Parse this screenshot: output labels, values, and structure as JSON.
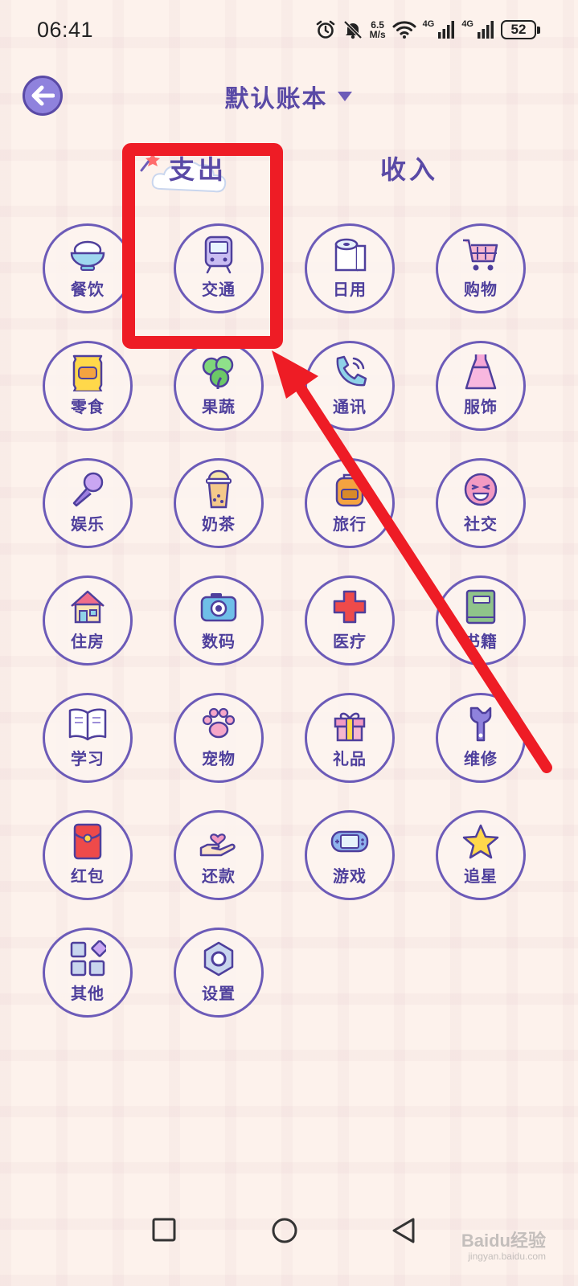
{
  "status_bar": {
    "time": "06:41",
    "speed_value": "6.5",
    "speed_unit": "M/s",
    "net1": "4G",
    "net2": "4G",
    "battery": "52"
  },
  "header": {
    "book_title": "默认账本"
  },
  "tabs": {
    "expense": "支出",
    "income": "收入"
  },
  "categories": [
    {
      "label": "餐饮",
      "icon": "rice-bowl-icon"
    },
    {
      "label": "交通",
      "icon": "train-icon"
    },
    {
      "label": "日用",
      "icon": "tissue-roll-icon"
    },
    {
      "label": "购物",
      "icon": "shopping-cart-icon"
    },
    {
      "label": "零食",
      "icon": "snack-bag-icon"
    },
    {
      "label": "果蔬",
      "icon": "vegetable-icon"
    },
    {
      "label": "通讯",
      "icon": "phone-icon"
    },
    {
      "label": "服饰",
      "icon": "dress-icon"
    },
    {
      "label": "娱乐",
      "icon": "microphone-icon"
    },
    {
      "label": "奶茶",
      "icon": "milk-tea-icon"
    },
    {
      "label": "旅行",
      "icon": "backpack-icon"
    },
    {
      "label": "社交",
      "icon": "smile-face-icon"
    },
    {
      "label": "住房",
      "icon": "house-icon"
    },
    {
      "label": "数码",
      "icon": "camera-icon"
    },
    {
      "label": "医疗",
      "icon": "medical-cross-icon"
    },
    {
      "label": "书籍",
      "icon": "book-icon"
    },
    {
      "label": "学习",
      "icon": "open-book-icon"
    },
    {
      "label": "宠物",
      "icon": "paw-icon"
    },
    {
      "label": "礼品",
      "icon": "gift-icon"
    },
    {
      "label": "维修",
      "icon": "wrench-icon"
    },
    {
      "label": "红包",
      "icon": "red-envelope-icon"
    },
    {
      "label": "还款",
      "icon": "hand-heart-icon"
    },
    {
      "label": "游戏",
      "icon": "game-console-icon"
    },
    {
      "label": "追星",
      "icon": "star-icon"
    },
    {
      "label": "其他",
      "icon": "grid-shapes-icon"
    },
    {
      "label": "设置",
      "icon": "nut-icon"
    }
  ],
  "colors": {
    "accent": "#5a4aa6",
    "annotation": "#ee1c25"
  },
  "watermark": {
    "brand": "Baidu经验",
    "url": "jingyan.baidu.com"
  }
}
